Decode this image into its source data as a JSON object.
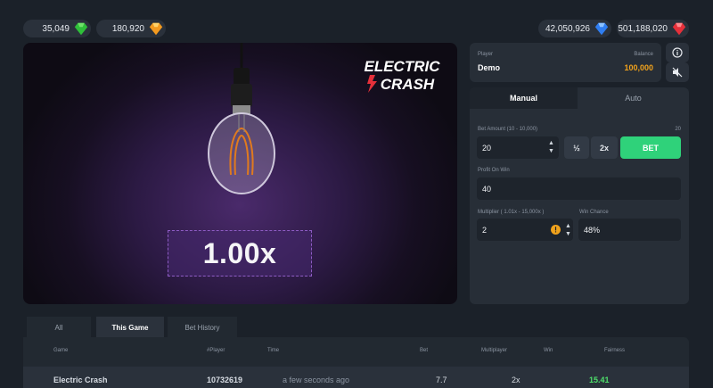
{
  "topbar": {
    "balances_left": [
      {
        "value": "35,049",
        "gem": "green-gem-icon",
        "color": "#2fbf3a"
      },
      {
        "value": "180,920",
        "gem": "orange-gem-icon",
        "color": "#f39a1f"
      }
    ],
    "balances_right": [
      {
        "value": "42,050,926",
        "gem": "blue-gem-icon",
        "color": "#2f7df0"
      },
      {
        "value": "501,188,020",
        "gem": "red-gem-icon",
        "color": "#e5303a"
      }
    ]
  },
  "game": {
    "logo_line1": "ELECTRIC",
    "logo_line2": "CRASH",
    "multiplier": "1.00x"
  },
  "player": {
    "player_label": "Player",
    "player_name": "Demo",
    "balance_label": "Balance",
    "balance_value": "100,000"
  },
  "side_buttons": [
    "info-icon",
    "sound-off-icon"
  ],
  "panel": {
    "tabs": [
      "Manual",
      "Auto"
    ],
    "bet_amount_label": "Bet Amount (10 - 10,000)",
    "bet_amount_right": "20",
    "bet_amount_value": "20",
    "half_label": "½",
    "double_label": "2x",
    "bet_label": "BET",
    "profit_label": "Profit On Win",
    "profit_value": "40",
    "multiplier_label": "Multiplier ( 1.01x - 15,000x )",
    "multiplier_value": "2",
    "win_chance_label": "Win Chance",
    "win_chance_value": "48%"
  },
  "history": {
    "tabs": [
      "All",
      "This Game",
      "Bet History"
    ],
    "active_tab": "This Game",
    "columns": [
      "Game",
      "#Player",
      "Time",
      "Bet",
      "Multiplayer",
      "Win",
      "Fairness"
    ],
    "rows": [
      {
        "game": "Electric Crash",
        "player": "10732619",
        "time": "a few seconds ago",
        "bet": "7.7",
        "multiplier": "2x",
        "win": "15.41"
      }
    ]
  },
  "colors": {
    "accent_green": "#2fd27a",
    "balance_orange": "#f0a21c",
    "win_green": "#4ee06b"
  }
}
